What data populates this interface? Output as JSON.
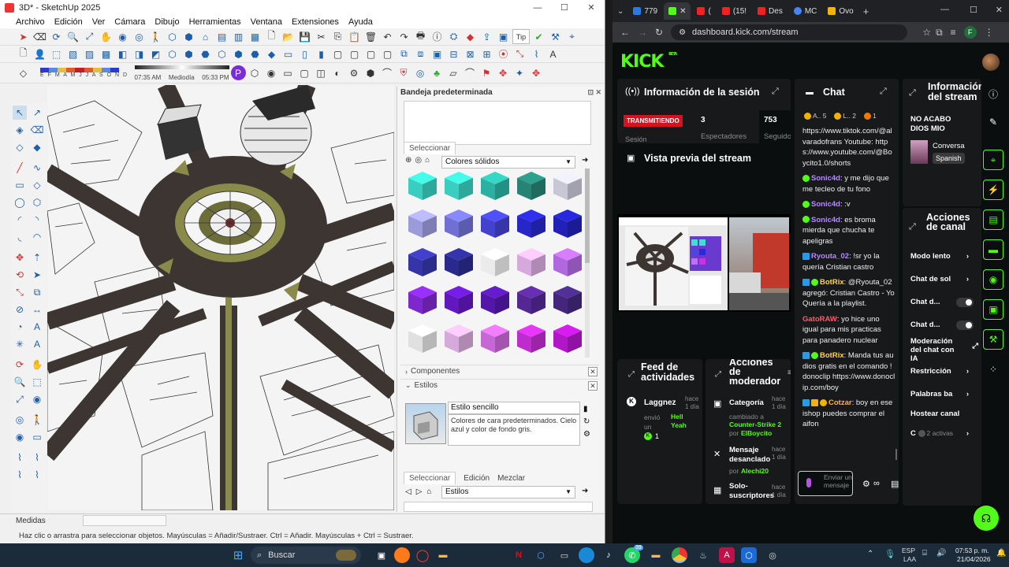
{
  "sketchup": {
    "title": "3D* - SketchUp 2025",
    "menu": [
      "Archivo",
      "Edición",
      "Ver",
      "Cámara",
      "Dibujo",
      "Herramientas",
      "Ventana",
      "Extensiones",
      "Ayuda"
    ],
    "sun_left": "07:35 AM",
    "sun_mid": "Mediodía",
    "sun_right": "05:33 PM",
    "months": "E F M A M J J A S O N D",
    "search_label": "Tip",
    "tray_title": "Bandeja predeterminada",
    "tab_select": "Seleccionar",
    "material_dropdown": "Colores sólidos",
    "components_label": "Componentes",
    "styles_label": "Estilos",
    "style_name": "Estilo sencillo",
    "style_desc": "Colores de cara predeterminados. Cielo azul y color de fondo gris.",
    "styles_tabs": [
      "Seleccionar",
      "Edición",
      "Mezclar"
    ],
    "styles_dropdown": "Estilos",
    "measures_label": "Medidas",
    "status_text": "Haz clic o arrastra para seleccionar objetos. Mayúsculas = Añadir/Sustraer. Ctrl = Añadir. Mayúsculas + Ctrl = Sustraer.",
    "cube_colors": [
      "#3ee0d0",
      "#3ee0d0",
      "#2fc0b0",
      "#2a8f7f",
      "#d8d8e8",
      "#a8a8ee",
      "#7a7ae6",
      "#4848e0",
      "#2a2ad8",
      "#2424c8",
      "#3a3ab8",
      "#2e2e9a",
      "#ffffff",
      "#e8b8f0",
      "#c070f0",
      "#8a2ae0",
      "#6a1ad0",
      "#5a18b8",
      "#5c2aa0",
      "#4a2a88",
      "#f4f4f4",
      "#e8b8ec",
      "#d870e8",
      "#d030e0",
      "#c018d8"
    ]
  },
  "browser": {
    "tabs": [
      {
        "label": "779",
        "color": "#2a7ae2"
      },
      {
        "label": "",
        "color": "#53fc18",
        "active": true
      },
      {
        "label": "(",
        "color": "#e22"
      },
      {
        "label": "(15!",
        "color": "#e22"
      },
      {
        "label": "Des",
        "color": "#e22"
      },
      {
        "label": "MC",
        "color": "#4285f4"
      },
      {
        "label": "Ovo",
        "color": "#f4b400"
      }
    ],
    "url": "dashboard.kick.com/stream",
    "profile_initial": "F"
  },
  "kick": {
    "logo": "KICK",
    "beta": "BETA",
    "session": {
      "title": "Información de la sesión",
      "live_badge": "TRANSMITIENDO",
      "session_label": "Sesión",
      "viewers_value": "3",
      "viewers_label": "Espectadores",
      "followers_value": "753",
      "followers_label": "Seguido"
    },
    "preview_title": "Vista previa del stream",
    "chat": {
      "title": "Chat",
      "badges": [
        "A.. 5",
        "L.. 2",
        "1"
      ],
      "messages": [
        {
          "user": "",
          "color": "#efeff1",
          "text": "https://www.tiktok.com/@alvaradofrans Youtube: https://www.youtube.com/@Boycito1.0/shorts"
        },
        {
          "user": "Sonic4d",
          "color": "#b48aff",
          "text": "y me dijo que me tecleo de tu fono"
        },
        {
          "user": "Sonic4d",
          "color": "#b48aff",
          "text": ":v"
        },
        {
          "user": "Sonic4d",
          "color": "#b48aff",
          "text": "es broma mierda que chucha te apeligras"
        },
        {
          "user": "Ryouta_02",
          "color": "#b48aff",
          "text": "!sr yo la quería Cristian castro"
        },
        {
          "user": "BotRix",
          "color": "#ffd54a",
          "text": "@Ryouta_02 agregó: Cristian Castro - Yo Quería a la playlist."
        },
        {
          "user": "GatoRAW",
          "color": "#ff5a6a",
          "text": "yo hice uno igual para mis practicas para panadero nuclear"
        },
        {
          "user": "BotRix",
          "color": "#ffd54a",
          "text": "Manda tus audios gratis en el comando !donoclip https://www.donoclip.com/boy"
        },
        {
          "user": "Cotzar",
          "color": "#ffb43a",
          "text": "boy en ese ishop puedes comprar el aifon"
        }
      ],
      "input_placeholder": "Enviar un mensaje"
    },
    "info": {
      "title": "Información del stream",
      "stream_title": "NO ACABO DIOS MIO",
      "category": "Conversa",
      "language": "Spanish"
    },
    "channel_actions": {
      "title": "Acciones de canal",
      "items": [
        {
          "label": "Modo lento",
          "type": "arrow"
        },
        {
          "label": "Chat de sol",
          "type": "arrow"
        },
        {
          "label": "Chat d...",
          "type": "toggle"
        },
        {
          "label": "Chat d...",
          "type": "toggle"
        },
        {
          "label": "Moderación del chat con IA",
          "type": "link"
        },
        {
          "label": "Restricción",
          "type": "arrow"
        },
        {
          "label": "Palabras ba",
          "type": "arrow"
        },
        {
          "label": "Hostear canal",
          "type": "none"
        },
        {
          "label": "C",
          "type": "arrow",
          "sub": "2 activas"
        }
      ]
    },
    "feed": {
      "title": "Feed de actividades",
      "user": "Laggnez",
      "time": "hace 1 día",
      "line1": "envió un",
      "gift": "Hell Yeah",
      "count": "1"
    },
    "mod": {
      "title": "Acciones de moderador",
      "items": [
        {
          "title": "Categoría",
          "time": "hace 1 día",
          "desc": "cambiado a",
          "value": "Counter-Strike 2",
          "by": "por",
          "user": "ElBoycito"
        },
        {
          "title": "Mensaje desanclado",
          "time": "hace 1 día",
          "desc": "",
          "value": "",
          "by": "por",
          "user": "Alechi20"
        },
        {
          "title": "Solo-suscriptores",
          "time": "hace 1 día",
          "desc": "",
          "value": "",
          "by": "",
          "user": ""
        }
      ]
    }
  },
  "taskbar": {
    "search": "Buscar",
    "lang": "ESP",
    "lang2": "LAA",
    "time": "07:53 p. m.",
    "date": "21/04/2026",
    "badge_count": "39"
  }
}
